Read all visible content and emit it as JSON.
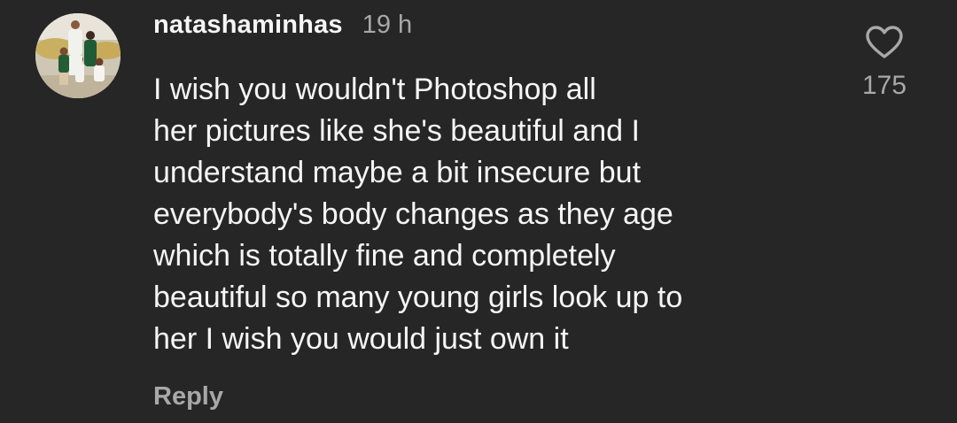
{
  "comment": {
    "username": "natashaminhas",
    "timestamp": "19 h",
    "text": "I wish you wouldn't Photoshop all\nher pictures like she's beautiful and I\nunderstand maybe a bit insecure but\neverybody's body changes as they age\nwhich is totally fine and completely\nbeautiful so many young girls look up to\nher I wish you would just own it",
    "reply_label": "Reply",
    "like_count": "175",
    "like_icon": "heart-outline-icon",
    "avatar": "family-photo-avatar"
  },
  "colors": {
    "background": "#262626",
    "primary_text": "#f5f5f5",
    "secondary_text": "#a8a8a8"
  }
}
